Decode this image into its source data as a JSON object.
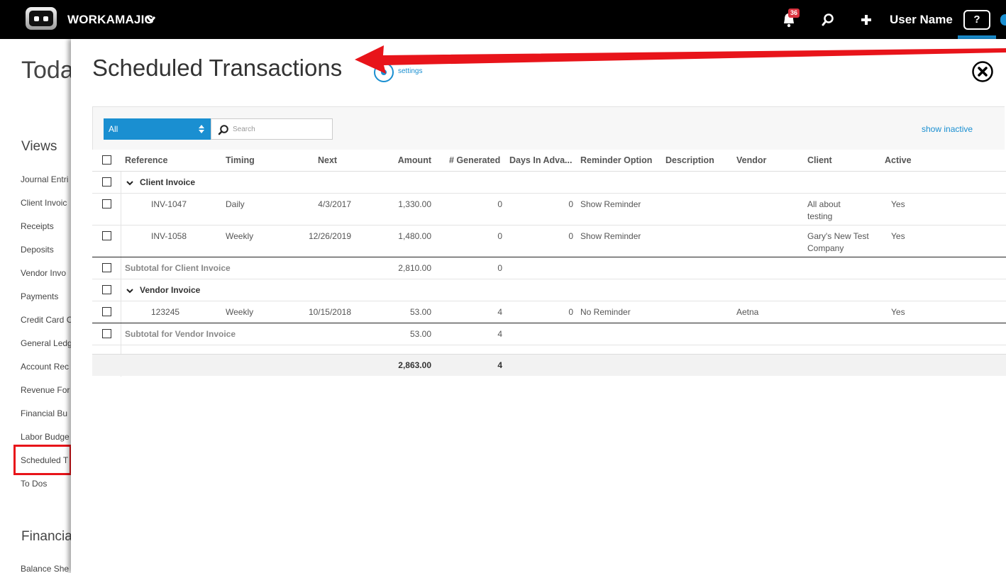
{
  "topbar": {
    "brand": "WORKAMAJIG",
    "notification_count": "36",
    "user_name": "User Name",
    "help_label": "?"
  },
  "background_page": {
    "title": "Toda",
    "views_heading": "Views",
    "sidebar_items": [
      "Journal Entri",
      "Client Invoic",
      "Receipts",
      "Deposits",
      "Vendor Invo",
      "Payments",
      "Credit Card C",
      "General Ledg",
      "Account Rec",
      "Revenue For",
      "Financial Bu",
      "Labor Budge",
      "Scheduled T",
      "To Dos"
    ],
    "financial_heading": "Financia",
    "financial_items": [
      "Balance She"
    ]
  },
  "panel": {
    "title": "Scheduled Transactions",
    "settings_label": "settings",
    "filter": {
      "selected": "All",
      "search_placeholder": "Search"
    },
    "show_inactive_label": "show inactive",
    "columns": [
      "Reference",
      "Timing",
      "Next",
      "Amount",
      "# Generated",
      "Days In Adva...",
      "Reminder Option",
      "Description",
      "Vendor",
      "Client",
      "Active"
    ],
    "groups": [
      {
        "name": "Client Invoice",
        "rows": [
          {
            "reference": "INV-1047",
            "timing": "Daily",
            "next": "4/3/2017",
            "amount": "1,330.00",
            "generated": "0",
            "days_in_advance": "0",
            "reminder": "Show Reminder",
            "description": "",
            "vendor": "",
            "client_line1": "All about",
            "client_line2": "testing",
            "active": "Yes"
          },
          {
            "reference": "INV-1058",
            "timing": "Weekly",
            "next": "12/26/2019",
            "amount": "1,480.00",
            "generated": "0",
            "days_in_advance": "0",
            "reminder": "Show Reminder",
            "description": "",
            "vendor": "",
            "client_line1": "Gary's New Test",
            "client_line2": "Company",
            "active": "Yes"
          }
        ],
        "subtotal_label": "Subtotal for Client Invoice",
        "subtotal_amount": "2,810.00",
        "subtotal_generated": "0"
      },
      {
        "name": "Vendor Invoice",
        "rows": [
          {
            "reference": "123245",
            "timing": "Weekly",
            "next": "10/15/2018",
            "amount": "53.00",
            "generated": "4",
            "days_in_advance": "0",
            "reminder": "No Reminder",
            "description": "",
            "vendor": "Aetna",
            "client_line1": "",
            "client_line2": "",
            "active": "Yes"
          }
        ],
        "subtotal_label": "Subtotal for Vendor Invoice",
        "subtotal_amount": "53.00",
        "subtotal_generated": "4"
      }
    ],
    "totals": {
      "amount": "2,863.00",
      "generated": "4"
    }
  },
  "colors": {
    "accent": "#1a8fd1",
    "annotation_red": "#e8141a",
    "badge_red": "#d9333f"
  }
}
